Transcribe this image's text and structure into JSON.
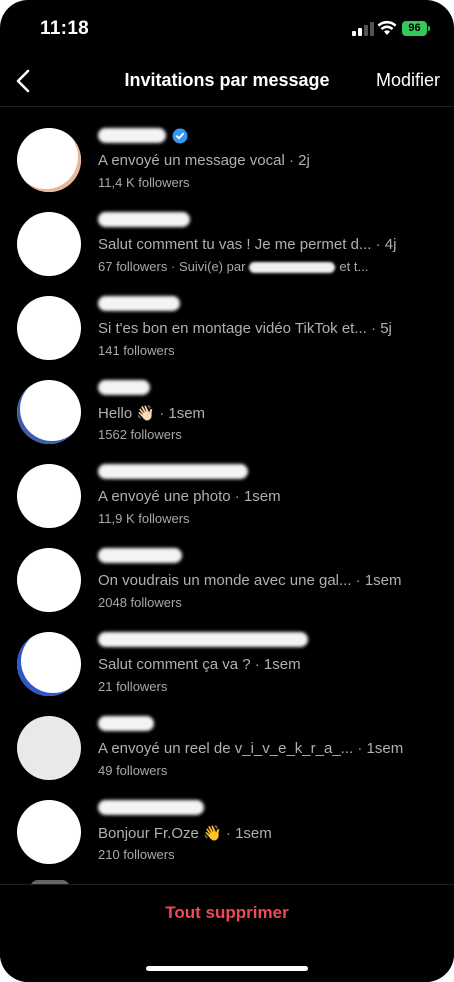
{
  "status_bar": {
    "time": "11:18",
    "battery": "96"
  },
  "nav": {
    "title": "Invitations par message",
    "edit": "Modifier"
  },
  "requests": [
    {
      "message": "A envoyé un message vocal",
      "time": "2j",
      "followers": "11,4 K followers",
      "verified": true,
      "mutual": ""
    },
    {
      "message": "Salut comment tu vas ! Je me permet d...",
      "time": "4j",
      "followers": "67 followers",
      "verified": false,
      "mutual": "Suivi(e) par",
      "mutual_tail": "et t..."
    },
    {
      "message": "Si t'es bon en montage vidéo TikTok et...",
      "time": "5j",
      "followers": "141 followers",
      "verified": false,
      "mutual": ""
    },
    {
      "message": "Hello 👋🏻",
      "time": "1sem",
      "followers": "1562 followers",
      "verified": false,
      "mutual": ""
    },
    {
      "message": "A envoyé une photo",
      "time": "1sem",
      "followers": "11,9 K followers",
      "verified": false,
      "mutual": ""
    },
    {
      "message": "On voudrais un monde avec une gal...",
      "time": "1sem",
      "followers": "2048 followers",
      "verified": false,
      "mutual": ""
    },
    {
      "message": "Salut comment ça va ?",
      "time": "1sem",
      "followers": "21 followers",
      "verified": false,
      "mutual": ""
    },
    {
      "message": "A envoyé un reel de v_i_v_e_k_r_a_...",
      "time": "1sem",
      "followers": "49 followers",
      "verified": false,
      "mutual": ""
    },
    {
      "message": "Bonjour Fr.Oze 👋",
      "time": "1sem",
      "followers": "210 followers",
      "verified": false,
      "mutual": ""
    }
  ],
  "footer": {
    "delete_all": "Tout supprimer"
  },
  "colors": {
    "background": "#000000",
    "danger": "#ed4956",
    "secondary_text": "#a8a8a8",
    "verified": "#3897f0",
    "battery": "#34c759"
  },
  "icons": {
    "back": "chevron-left-icon",
    "verified": "verified-badge-icon",
    "signal": "signal-icon",
    "wifi": "wifi-icon",
    "battery": "battery-icon"
  }
}
